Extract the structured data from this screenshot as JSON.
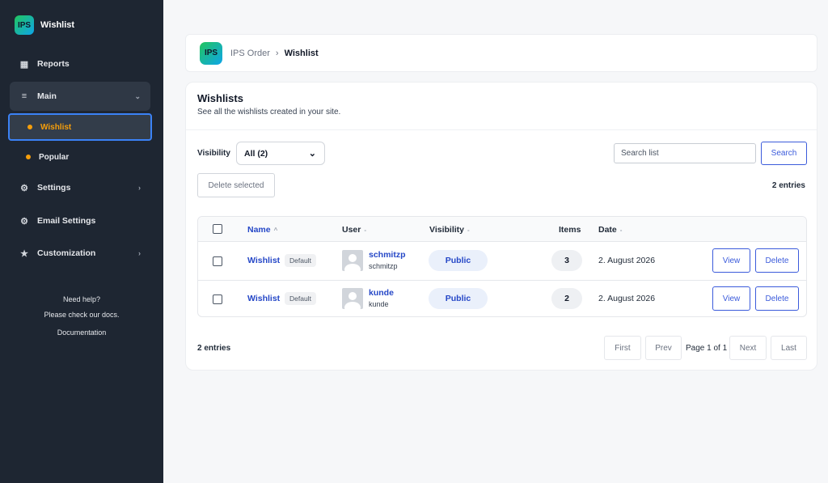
{
  "app": {
    "logo_text": "IPS",
    "name": "Wishlist"
  },
  "sidebar": {
    "reports": "Reports",
    "main": "Main",
    "sub_items": [
      "Wishlist",
      "Popular"
    ],
    "settings": "Settings",
    "email_settings": "Email Settings",
    "customization": "Customization",
    "help_title": "Need help?",
    "help_text": "Please check our docs.",
    "help_link": "Documentation"
  },
  "breadcrumb": {
    "logo_text": "IPS",
    "root": "IPS Order",
    "separator": "›",
    "current": "Wishlist"
  },
  "page": {
    "title": "Wishlists",
    "subtitle": "See all the wishlists created in your site."
  },
  "filters": {
    "visibility_label": "Visibility",
    "visibility_value": "All (2)",
    "search_placeholder": "Search list",
    "search_button": "Search",
    "delete_selected": "Delete selected",
    "entries": "2 entries"
  },
  "table": {
    "headers": {
      "name": "Name",
      "user": "User",
      "visibility": "Visibility",
      "items": "Items",
      "date": "Date"
    },
    "sort_icons": {
      "name": "^",
      "user": "-",
      "visibility": "-",
      "date": "-"
    },
    "rows": [
      {
        "name": "Wishlist",
        "badge": "Default",
        "user_name": "schmitzp",
        "user_login": "schmitzp",
        "visibility": "Public",
        "items": "3",
        "date": "2. August 2026",
        "view": "View",
        "delete": "Delete"
      },
      {
        "name": "Wishlist",
        "badge": "Default",
        "user_name": "kunde",
        "user_login": "kunde",
        "visibility": "Public",
        "items": "2",
        "date": "2. August 2026",
        "view": "View",
        "delete": "Delete"
      }
    ]
  },
  "pagination": {
    "entries": "2 entries",
    "first": "First",
    "prev": "Prev",
    "info": "Page 1 of 1",
    "next": "Next",
    "last": "Last"
  },
  "icons": {
    "reports": "▦",
    "main": "≡",
    "settings": "⚙",
    "email_settings": "⚙",
    "customization": "★",
    "chevron_down": "⌄",
    "chevron_right": "›"
  },
  "colors": {
    "sidebar_bg": "#1e2632",
    "accent_blue": "#2547c7",
    "active_orange": "#f59e0b"
  }
}
